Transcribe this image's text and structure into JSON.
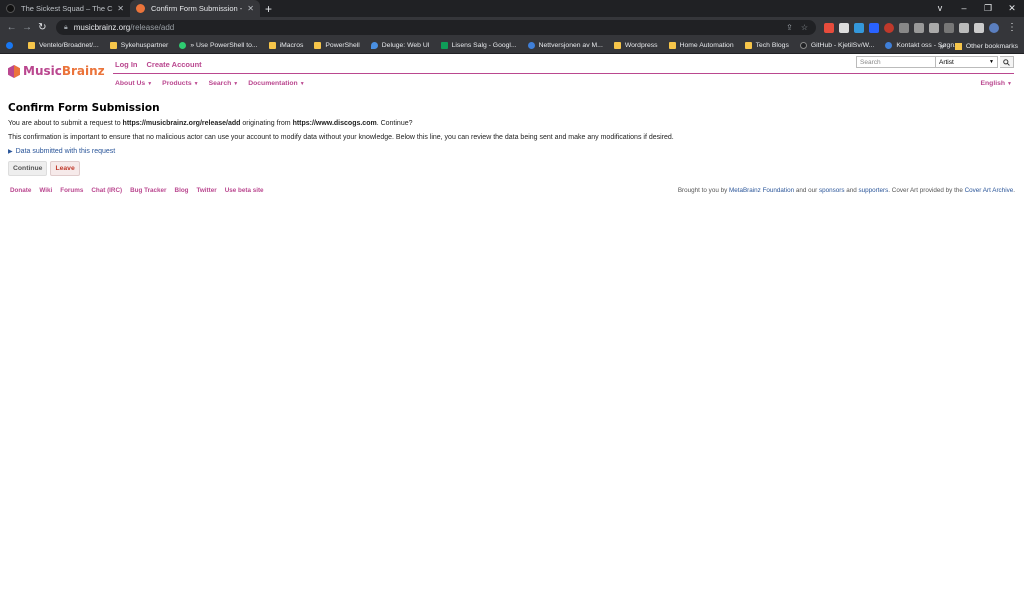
{
  "browser": {
    "tabs": [
      {
        "title": "The Sickest Squad – The Celebr",
        "favicon_color": "#111111",
        "active": false
      },
      {
        "title": "Confirm Form Submission - Mus",
        "favicon_color": "#eb743b",
        "active": true
      }
    ],
    "new_tab_icon": "plus-icon",
    "window_controls": [
      "v",
      "–",
      "❐",
      "✕"
    ],
    "url_domain": "musicbrainz.org",
    "url_path": "/release/add",
    "bookmarks": [
      {
        "label": "",
        "icon": "facebook-icon",
        "color": "#1877f2"
      },
      {
        "label": "Ventelo/Broadnet/...",
        "icon": "folder-icon",
        "color": "#f6c54a"
      },
      {
        "label": "Sykehuspartner",
        "icon": "folder-icon",
        "color": "#f6c54a"
      },
      {
        "label": "» Use PowerShell to...",
        "icon": "globe-icon",
        "color": "#2ecc71"
      },
      {
        "label": "iMacros",
        "icon": "folder-icon",
        "color": "#f6c54a"
      },
      {
        "label": "PowerShell",
        "icon": "folder-icon",
        "color": "#f6c54a"
      },
      {
        "label": "Deluge: Web UI",
        "icon": "drop-icon",
        "color": "#4a90e2"
      },
      {
        "label": "Lisens Salg - Googl...",
        "icon": "sheets-icon",
        "color": "#0f9d58"
      },
      {
        "label": "Nettversjonen av M...",
        "icon": "mail-icon",
        "color": "#3f7fd8"
      },
      {
        "label": "Wordpress",
        "icon": "folder-icon",
        "color": "#f6c54a"
      },
      {
        "label": "Home Automation",
        "icon": "folder-icon",
        "color": "#f6c54a"
      },
      {
        "label": "Tech Blogs",
        "icon": "folder-icon",
        "color": "#f6c54a"
      },
      {
        "label": "GitHub - KjetilSv/W...",
        "icon": "github-icon",
        "color": "#202124"
      },
      {
        "label": "Kontakt oss - Søgn...",
        "icon": "moon-icon",
        "color": "#3f7fd8"
      }
    ],
    "bookmarks_more": "»",
    "other_bookmarks": "Other bookmarks"
  },
  "site": {
    "logo_music": "Music",
    "logo_brainz": "Brainz",
    "top_links": {
      "login": "Log In",
      "create_account": "Create Account"
    },
    "search": {
      "placeholder": "Search",
      "type_selected": "Artist"
    },
    "menu": {
      "about": "About Us",
      "products": "Products",
      "search": "Search",
      "documentation": "Documentation",
      "language": "English"
    }
  },
  "main": {
    "title": "Confirm Form Submission",
    "p1_prefix": "You are about to submit a request to ",
    "p1_target": "https://musicbrainz.org/release/add",
    "p1_mid": " originating from ",
    "p1_origin": "https://www.discogs.com",
    "p1_suffix": ". Continue?",
    "p2": "This confirmation is important to ensure that no malicious actor can use your account to modify data without your knowledge. Below this line, you can review the data being sent and make any modifications if desired.",
    "details_toggle": "Data submitted with this request",
    "continue_label": "Continue",
    "leave_label": "Leave"
  },
  "footer": {
    "links": [
      "Donate",
      "Wiki",
      "Forums",
      "Chat (IRC)",
      "Bug Tracker",
      "Blog",
      "Twitter",
      "Use beta site"
    ],
    "brought_prefix": "Brought to you by ",
    "metabrainz": "MetaBrainz Foundation",
    "and_our": " and our ",
    "sponsors": "sponsors",
    "and": " and ",
    "supporters": "supporters",
    "cover_art_prefix": ". Cover Art provided by the ",
    "cover_art": "Cover Art Archive",
    "end": "."
  }
}
